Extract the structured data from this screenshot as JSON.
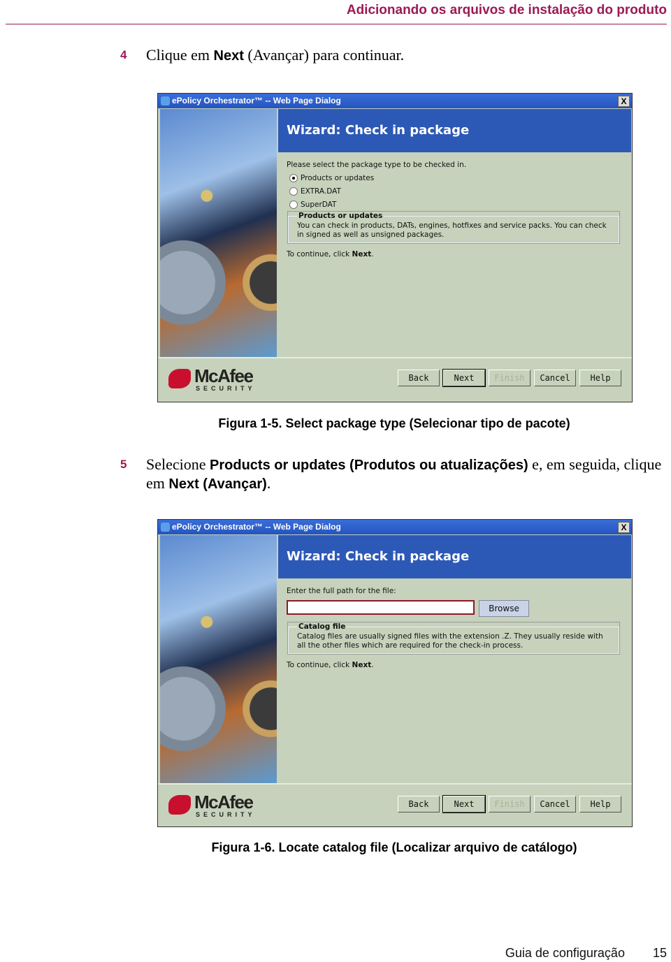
{
  "header": {
    "title": "Adicionando os arquivos de instalação do produto"
  },
  "steps": [
    {
      "number": "4",
      "pre": "Clique em ",
      "bold": "Next",
      "post": " (Avançar) para continuar."
    },
    {
      "number": "5",
      "pre": "Selecione ",
      "bold": "Products or updates (Produtos ou atualizações)",
      "mid": " e, em seguida, clique em ",
      "bold2": "Next (Avançar)",
      "post": "."
    }
  ],
  "dialog1": {
    "title": "ePolicy Orchestrator™ -- Web Page Dialog",
    "close": "X",
    "banner": "Wizard:  Check in package",
    "prompt": "Please select the package type to be checked in.",
    "options": [
      {
        "label": "Products or updates",
        "selected": true
      },
      {
        "label": "EXTRA.DAT",
        "selected": false
      },
      {
        "label": "SuperDAT",
        "selected": false
      }
    ],
    "group_title": "Products or updates",
    "group_text": "You can check in products, DATs, engines, hotfixes and service packs. You can check in signed as well as unsigned packages.",
    "continue_pre": "To continue, click ",
    "continue_bold": "Next",
    "logo": {
      "name": "McAfee",
      "sub": "SECURITY"
    },
    "buttons": {
      "back": "Back",
      "next": "Next",
      "finish": "Finish",
      "cancel": "Cancel",
      "help": "Help"
    }
  },
  "caption1": "Figura 1-5. Select package type (Selecionar tipo de pacote)",
  "dialog2": {
    "title": "ePolicy Orchestrator™ -- Web Page Dialog",
    "close": "X",
    "banner": "Wizard:  Check in package",
    "prompt": "Enter the full path for the file:",
    "path_value": "",
    "browse": "Browse",
    "group_title": "Catalog file",
    "group_text": "Catalog files are usually signed files with the extension .Z. They usually reside with all the other files which are required for the check-in process.",
    "continue_pre": "To continue, click ",
    "continue_bold": "Next",
    "logo": {
      "name": "McAfee",
      "sub": "SECURITY"
    },
    "buttons": {
      "back": "Back",
      "next": "Next",
      "finish": "Finish",
      "cancel": "Cancel",
      "help": "Help"
    }
  },
  "caption2": "Figura 1-6. Locate catalog file (Localizar arquivo de catálogo)",
  "footer": {
    "guide": "Guia de configuração",
    "page": "15"
  },
  "colors": {
    "accent": "#9c1a55",
    "banner": "#2d59b6",
    "dialog_bg": "#c6d2bb"
  }
}
